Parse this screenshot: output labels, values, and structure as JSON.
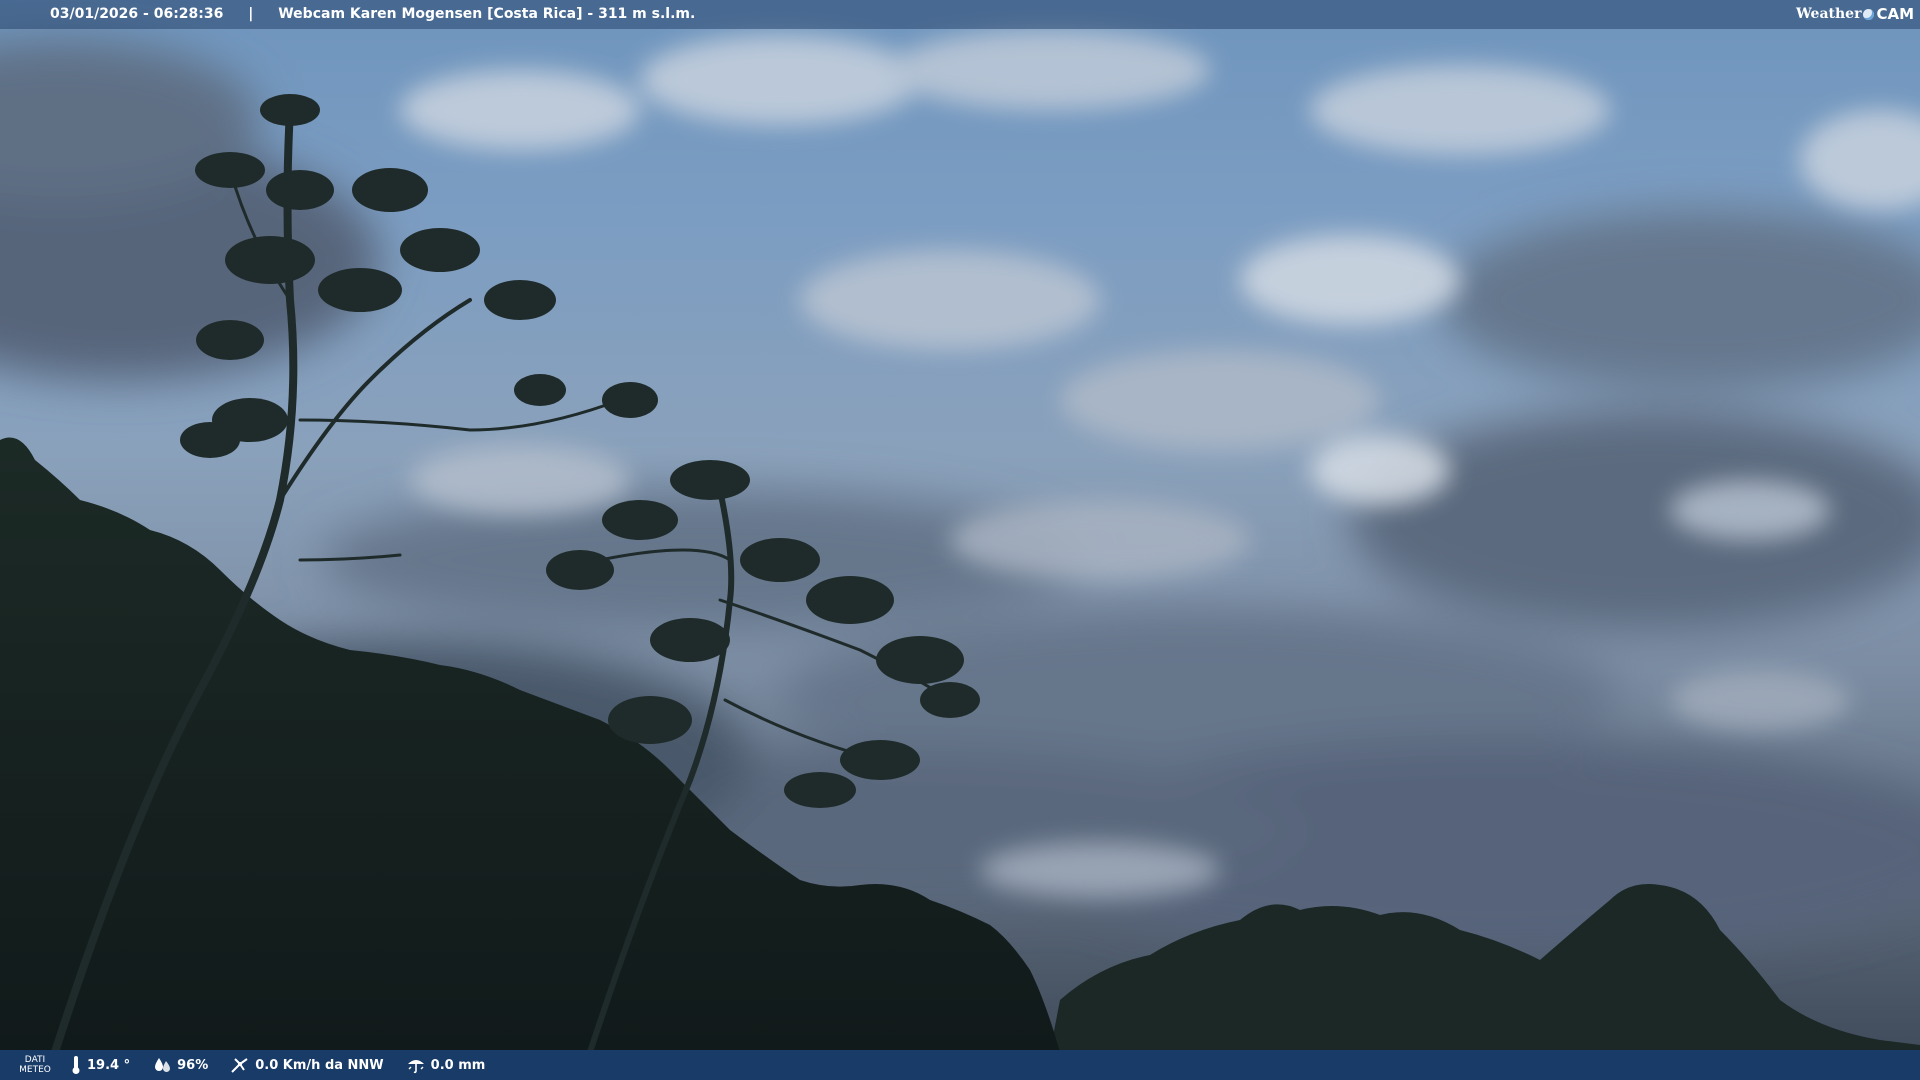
{
  "overlay": {
    "timestamp": "03/01/2026 - 06:28:36",
    "separator": "|",
    "webcam_name": "Webcam Karen Mogensen [Costa Rica]",
    "altitude": "- 311 m s.l.m."
  },
  "brand": {
    "left": "Weather",
    "right": "CAM"
  },
  "weather": {
    "label_line1": "DATI",
    "label_line2": "METEO",
    "temperature": "19.4 °",
    "humidity": "96%",
    "wind": "0.0 Km/h da NNW",
    "rain": "0.0 mm"
  },
  "colors": {
    "bottom_bar": "#183b68",
    "top_bar": "#28466e"
  },
  "icons": [
    "thermometer-icon",
    "humidity-icon",
    "wind-icon",
    "rain-icon"
  ]
}
